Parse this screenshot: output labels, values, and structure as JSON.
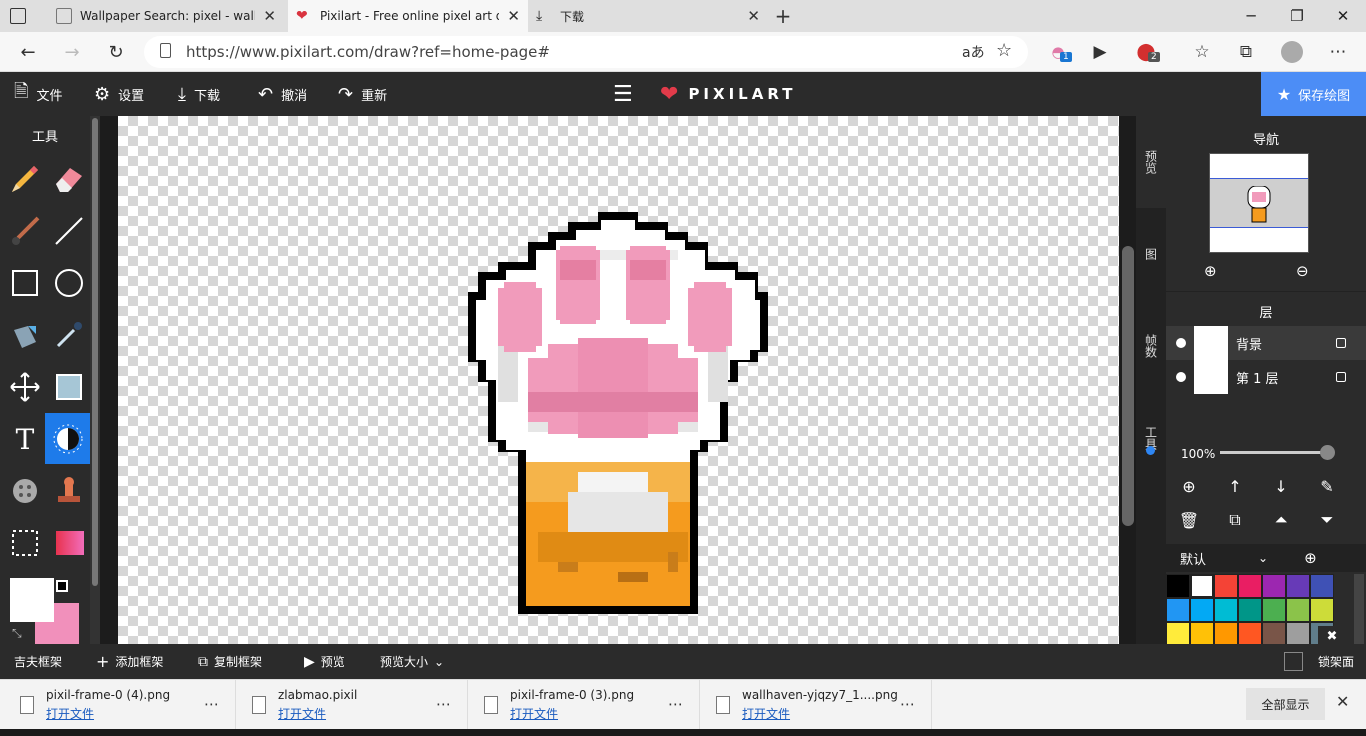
{
  "browser": {
    "tabs": [
      {
        "title": "Wallpaper Search: pixel - wallhav",
        "icon": "wallhaven-icon"
      },
      {
        "title": "Pixilart - Free online pixel art dra",
        "icon": "pixilart-heart-icon"
      },
      {
        "title": "下载",
        "icon": "download-icon"
      }
    ],
    "url": "https://www.pixilart.com/draw?ref=home-page#",
    "ext_badge_1": "1",
    "ext_badge_2": "2"
  },
  "toolbar": {
    "file": "文件",
    "settings": "设置",
    "download": "下载",
    "undo": "撤消",
    "redo": "重新",
    "brand": "PIXILART",
    "save": "保存绘图"
  },
  "tools": {
    "title": "工具",
    "items": [
      "pencil-tool",
      "eraser-tool",
      "brush-tool",
      "line-tool",
      "rectangle-tool",
      "circle-tool",
      "bucket-tool",
      "eyedropper-tool",
      "move-tool",
      "shape-fill-tool",
      "text-tool",
      "lighten-darken-tool",
      "dither-tool",
      "stamp-tool",
      "select-tool",
      "gradient-tool"
    ],
    "primary_color": "#ffffff",
    "secondary_color": "#f190bb"
  },
  "right_tabs": [
    "预览",
    "图",
    "帧数",
    "工具"
  ],
  "navigator": {
    "title": "导航"
  },
  "layers": {
    "title": "层",
    "items": [
      {
        "name": "背景"
      },
      {
        "name": "第 1 层"
      }
    ],
    "opacity": "100%"
  },
  "palette": {
    "name": "默认",
    "colors": [
      "#000000",
      "#ffffff",
      "#f44336",
      "#e91e63",
      "#9c27b0",
      "#673ab7",
      "#3f51b5",
      "#2196f3",
      "#03a9f4",
      "#00bcd4",
      "#009688",
      "#4caf50",
      "#8bc34a",
      "#cddc39",
      "#ffeb3b",
      "#ffc107",
      "#ff9800",
      "#ff5722",
      "#795548",
      "#9e9e9e",
      "#607d8b"
    ]
  },
  "bottom": {
    "frames": "吉夫框架",
    "add_frame": "添加框架",
    "copy_frame": "复制框架",
    "preview": "预览",
    "preview_size": "预览大小",
    "lock_frame": "锁架面"
  },
  "downloads": {
    "items": [
      {
        "name": "pixil-frame-0 (4).png",
        "action": "打开文件"
      },
      {
        "name": "zlabmao.pixil",
        "action": "打开文件"
      },
      {
        "name": "pixil-frame-0 (3).png",
        "action": "打开文件"
      },
      {
        "name": "wallhaven-yjqzy7_1....png",
        "action": "打开文件"
      }
    ],
    "show_all": "全部显示"
  }
}
